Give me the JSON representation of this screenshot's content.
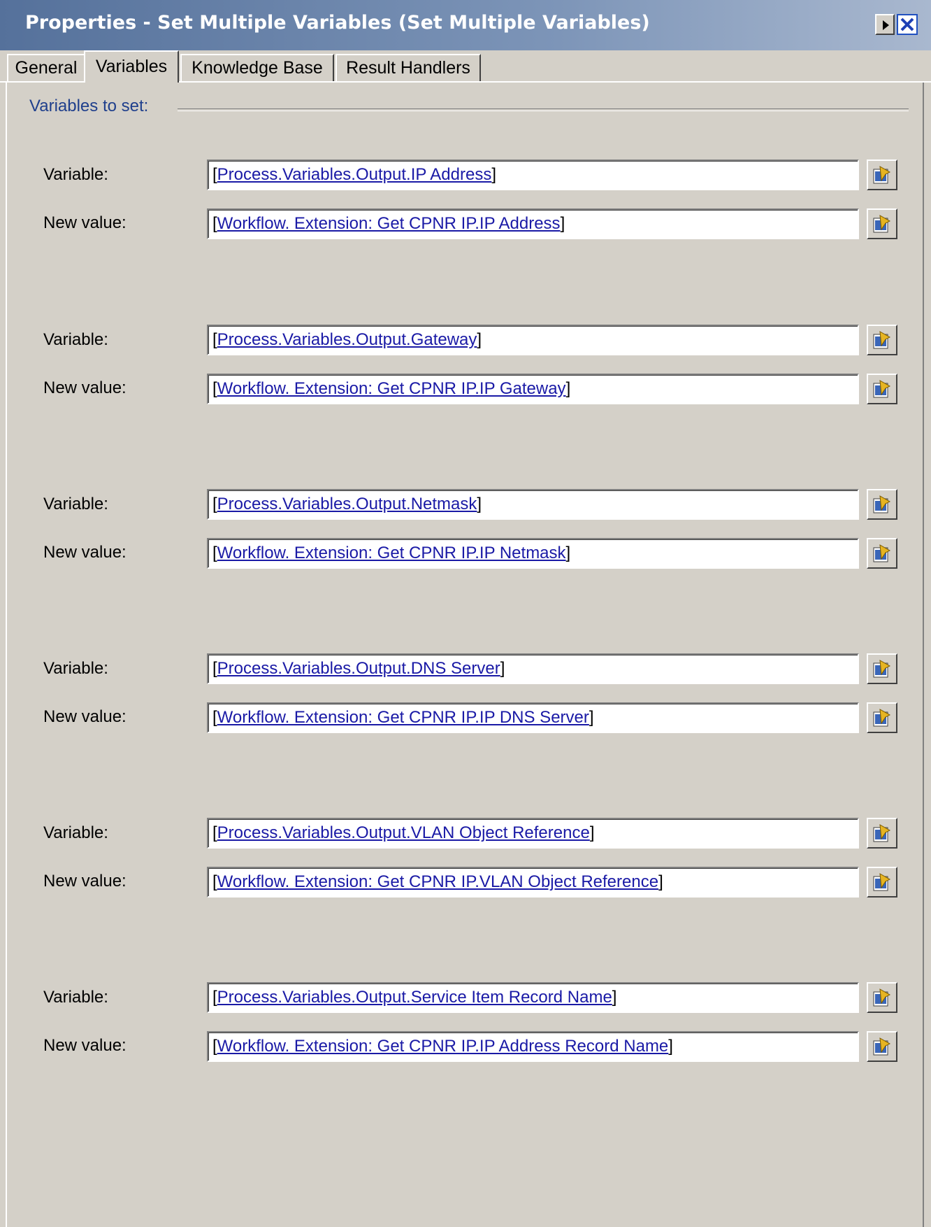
{
  "window": {
    "title": "Properties - Set Multiple Variables  (Set Multiple Variables)"
  },
  "tabs": [
    {
      "label": "General",
      "active": false
    },
    {
      "label": "Variables",
      "active": true
    },
    {
      "label": "Knowledge Base",
      "active": false
    },
    {
      "label": "Result Handlers",
      "active": false
    }
  ],
  "section": {
    "label": "Variables to set:"
  },
  "labels": {
    "variable": "Variable:",
    "new_value": "New value:"
  },
  "rows": [
    {
      "variable": "Process.Variables.Output.IP Address",
      "new_value": "Workflow. Extension: Get CPNR IP.IP Address"
    },
    {
      "variable": "Process.Variables.Output.Gateway",
      "new_value": "Workflow. Extension: Get CPNR IP.IP Gateway"
    },
    {
      "variable": "Process.Variables.Output.Netmask",
      "new_value": "Workflow. Extension: Get CPNR IP.IP Netmask"
    },
    {
      "variable": "Process.Variables.Output.DNS Server",
      "new_value": "Workflow. Extension: Get CPNR IP.IP DNS Server"
    },
    {
      "variable": "Process.Variables.Output.VLAN Object Reference",
      "new_value": "Workflow. Extension: Get CPNR IP.VLAN Object Reference"
    },
    {
      "variable": "Process.Variables.Output.Service Item Record Name",
      "new_value": "Workflow. Extension: Get CPNR IP.IP Address Record Name"
    }
  ],
  "icons": {
    "browse": "browse-reference-icon",
    "arrow": "play-arrow-icon",
    "close": "close-icon"
  }
}
